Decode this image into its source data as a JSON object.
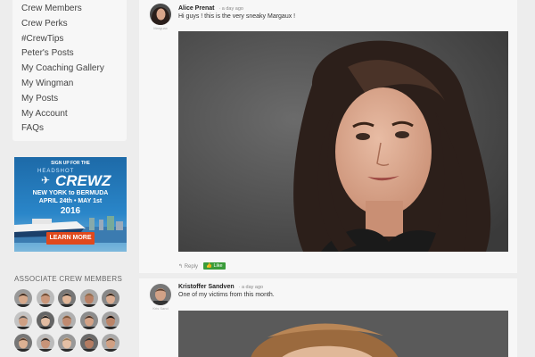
{
  "sidebar": {
    "nav": [
      "Crew Members",
      "Crew Perks",
      "#CrewTips",
      "Peter's Posts",
      "My Coaching Gallery",
      "My Wingman",
      "My Posts",
      "My Account",
      "FAQs"
    ],
    "banner": {
      "sign_up": "SIGN UP FOR THE",
      "brand_top": "HEADSHOT",
      "brand": "CREWZ",
      "route": "NEW YORK to BERMUDA",
      "dates": "APRIL 24th • MAY 1st",
      "year": "2016",
      "cta": "LEARN MORE"
    },
    "associates_title": "ASSOCIATE CREW MEMBERS"
  },
  "posts": [
    {
      "author": "Alice Prenat",
      "time": "· a day ago",
      "message": "Hi guys ! this is the very sneaky Margaux !",
      "reply": "Reply",
      "like": "Like",
      "avatar_caption": "Marguax"
    },
    {
      "author": "Kristoffer Sandven",
      "time": "· a day ago",
      "message": "One of my victims from this month.",
      "avatar_caption": "Kris Sand"
    }
  ],
  "colors": {
    "background": "#ededed",
    "card": "#f7f7f7",
    "like_green": "#3a9c3a",
    "cta_orange": "#e0491c",
    "banner_blue": "#2a86c9"
  }
}
